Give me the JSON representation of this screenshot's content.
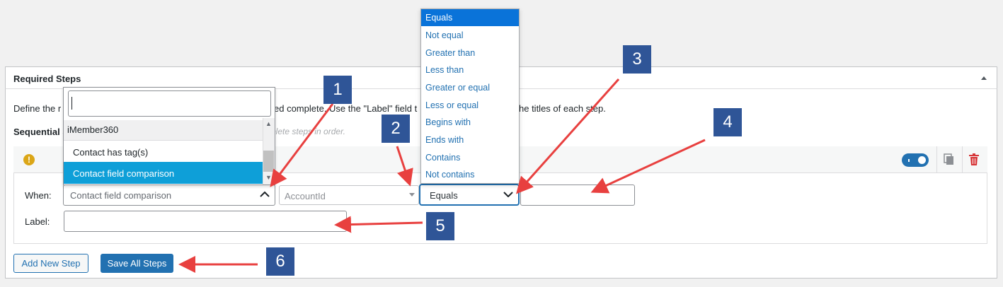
{
  "panel": {
    "title": "Required Steps",
    "description": {
      "part_a": "Define the r",
      "part_b": "ed complete. Use the \"Label\" field t",
      "part_c": "he titles of each step."
    },
    "sequential_label": "Sequential S",
    "sequential_hint": "plete steps in order."
  },
  "step": {
    "warning_icon": "exclamation-icon",
    "enabled": true,
    "copy_icon": "copy-icon",
    "delete_icon": "trash-icon",
    "when_label": "When:",
    "label_label": "Label:",
    "when_value": "Contact field comparison",
    "field_value": "AccountId",
    "operator_value": "Equals",
    "value_input": "",
    "label_input": ""
  },
  "when_dropdown": {
    "search_value": "",
    "group": "iMember360",
    "options": [
      "Contact has tag(s)",
      "Contact field comparison"
    ],
    "selected": "Contact field comparison"
  },
  "operator_list": {
    "options": [
      "Equals",
      "Not equal",
      "Greater than",
      "Less than",
      "Greater or equal",
      "Less or equal",
      "Begins with",
      "Ends with",
      "Contains",
      "Not contains"
    ],
    "highlighted": "Equals"
  },
  "buttons": {
    "add": "Add New Step",
    "save": "Save All Steps"
  },
  "callouts": [
    "1",
    "2",
    "3",
    "4",
    "5",
    "6"
  ],
  "colors": {
    "primary": "#2271b1",
    "highlight": "#0e9fd8",
    "callout": "#2f5597",
    "arrow": "#e8403f",
    "warning": "#dba617",
    "delete": "#d63638"
  }
}
